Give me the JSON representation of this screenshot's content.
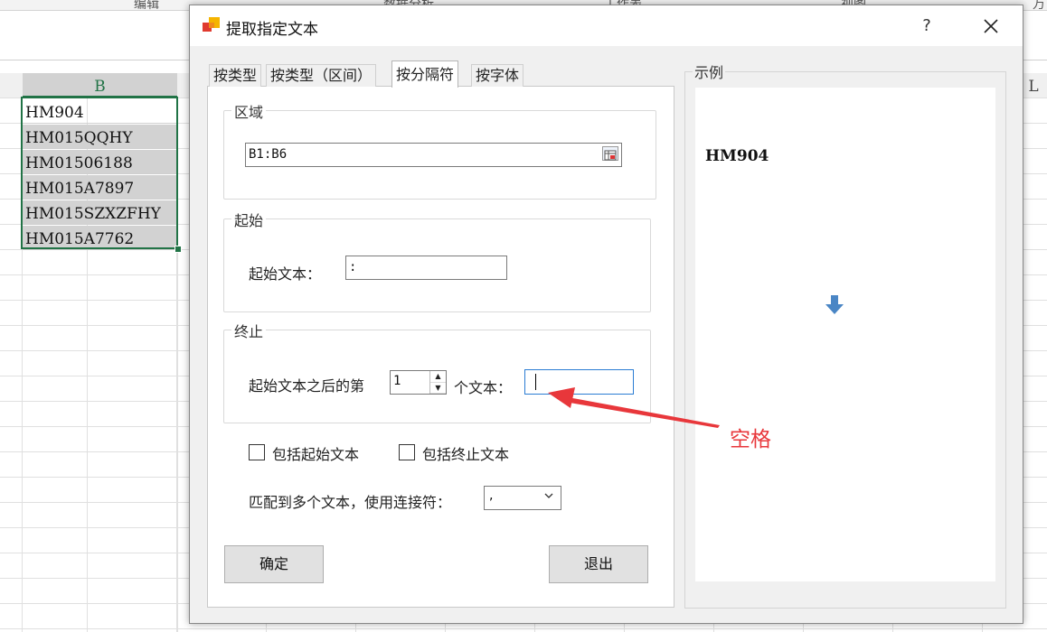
{
  "spreadsheet": {
    "ribbon_fragments": [
      "编辑",
      "数据分析",
      "工作表",
      "视图",
      "万"
    ],
    "columns": {
      "B": "B",
      "L": "L"
    },
    "cells": [
      "HM904",
      "HM015QQHY",
      "HM01506188",
      "HM015A7897",
      "HM015SZXZFHY",
      "HM015A7762"
    ]
  },
  "dialog": {
    "title": "提取指定文本",
    "help": "?",
    "tabs": [
      {
        "label": "按类型"
      },
      {
        "label": "按类型（区间）"
      },
      {
        "label": "按分隔符",
        "active": true
      },
      {
        "label": "按字体"
      }
    ],
    "region": {
      "label": "区域",
      "value": "B1:B6"
    },
    "start": {
      "group_label": "起始",
      "field_label": "起始文本：",
      "value": ":"
    },
    "end": {
      "group_label": "终止",
      "prefix": "起始文本之后的第",
      "spin_value": "1",
      "suffix": "个文本：",
      "value": ""
    },
    "options": {
      "include_start": {
        "label": "包括起始文本",
        "checked": false
      },
      "include_end": {
        "label": "包括终止文本",
        "checked": false
      }
    },
    "joiner": {
      "label": "匹配到多个文本，使用连接符：",
      "value": ","
    },
    "buttons": {
      "ok": "确定",
      "exit": "退出"
    },
    "sample": {
      "label": "示例",
      "text": "HM904"
    }
  },
  "annotation": {
    "text": "空格",
    "color": "#e8373b"
  },
  "colors": {
    "excel_green": "#217346",
    "focus_blue": "#2a7cd3",
    "arrow_blue": "#4a86c5"
  }
}
